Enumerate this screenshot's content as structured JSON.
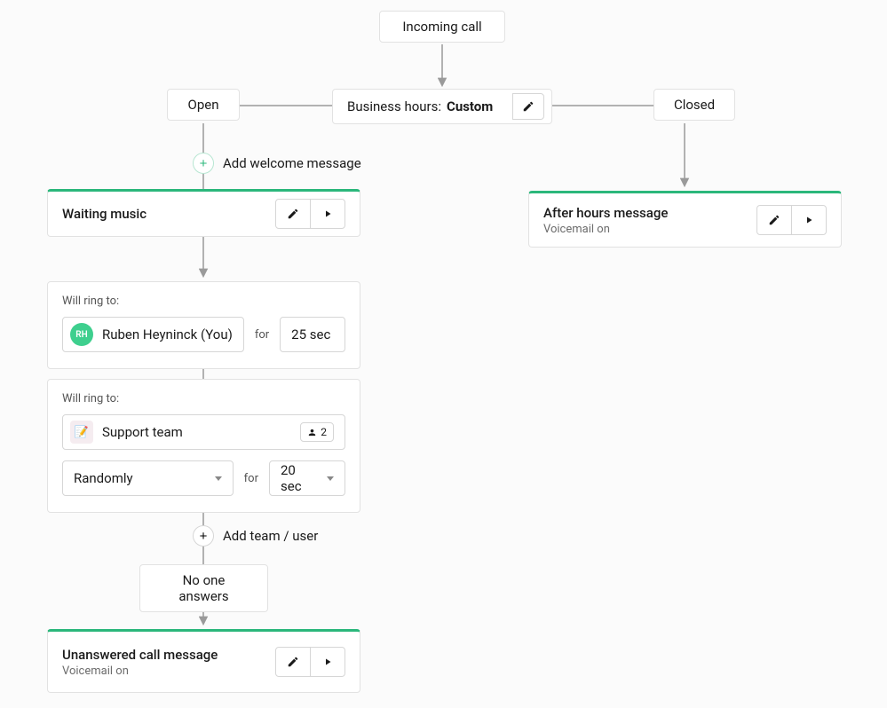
{
  "root": {
    "label": "Incoming call"
  },
  "business_hours": {
    "label": "Business hours:",
    "value": "Custom"
  },
  "branch_open": {
    "label": "Open"
  },
  "branch_closed": {
    "label": "Closed"
  },
  "add_welcome": {
    "label": "Add welcome message"
  },
  "waiting_music": {
    "title": "Waiting music"
  },
  "ring1": {
    "label": "Will ring to:",
    "user_initials": "RH",
    "user_name": "Ruben Heyninck (You)",
    "for_label": "for",
    "duration": "25 sec"
  },
  "ring2": {
    "label": "Will ring to:",
    "team_name": "Support team",
    "team_count": "2",
    "strategy": "Randomly",
    "for_label": "for",
    "duration": "20 sec"
  },
  "add_team": {
    "label": "Add team / user"
  },
  "no_answer": {
    "label": "No one answers"
  },
  "unanswered": {
    "title": "Unanswered call message",
    "sub": "Voicemail on"
  },
  "after_hours": {
    "title": "After hours message",
    "sub": "Voicemail on"
  }
}
